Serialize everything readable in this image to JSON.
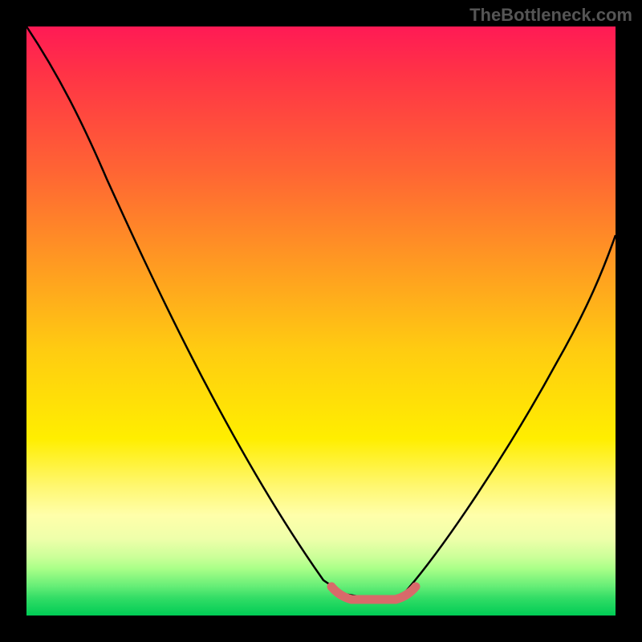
{
  "watermark": "TheBottleneck.com",
  "chart_data": {
    "type": "line",
    "title": "",
    "xlabel": "",
    "ylabel": "",
    "xlim": [
      0,
      100
    ],
    "ylim": [
      0,
      100
    ],
    "grid": false,
    "description": "V-shaped bottleneck curve with minimum between x≈54 and x≈62; heat-map gradient background indicates low (green, bottom) to high (red, top) bottleneck; red marker band highlights the minimum region",
    "series": [
      {
        "name": "curve",
        "x": [
          0,
          5,
          10,
          15,
          20,
          25,
          30,
          35,
          40,
          45,
          50,
          54,
          58,
          62,
          66,
          70,
          75,
          80,
          85,
          90,
          95,
          100
        ],
        "values": [
          100,
          95,
          88,
          80,
          72,
          63,
          54,
          45,
          36,
          27,
          17,
          6,
          2,
          6,
          14,
          22,
          32,
          41,
          49,
          56,
          62,
          67
        ]
      }
    ],
    "marker_band": {
      "x_start": 50,
      "x_end": 63,
      "y": 3,
      "color": "#d86a6a"
    }
  }
}
